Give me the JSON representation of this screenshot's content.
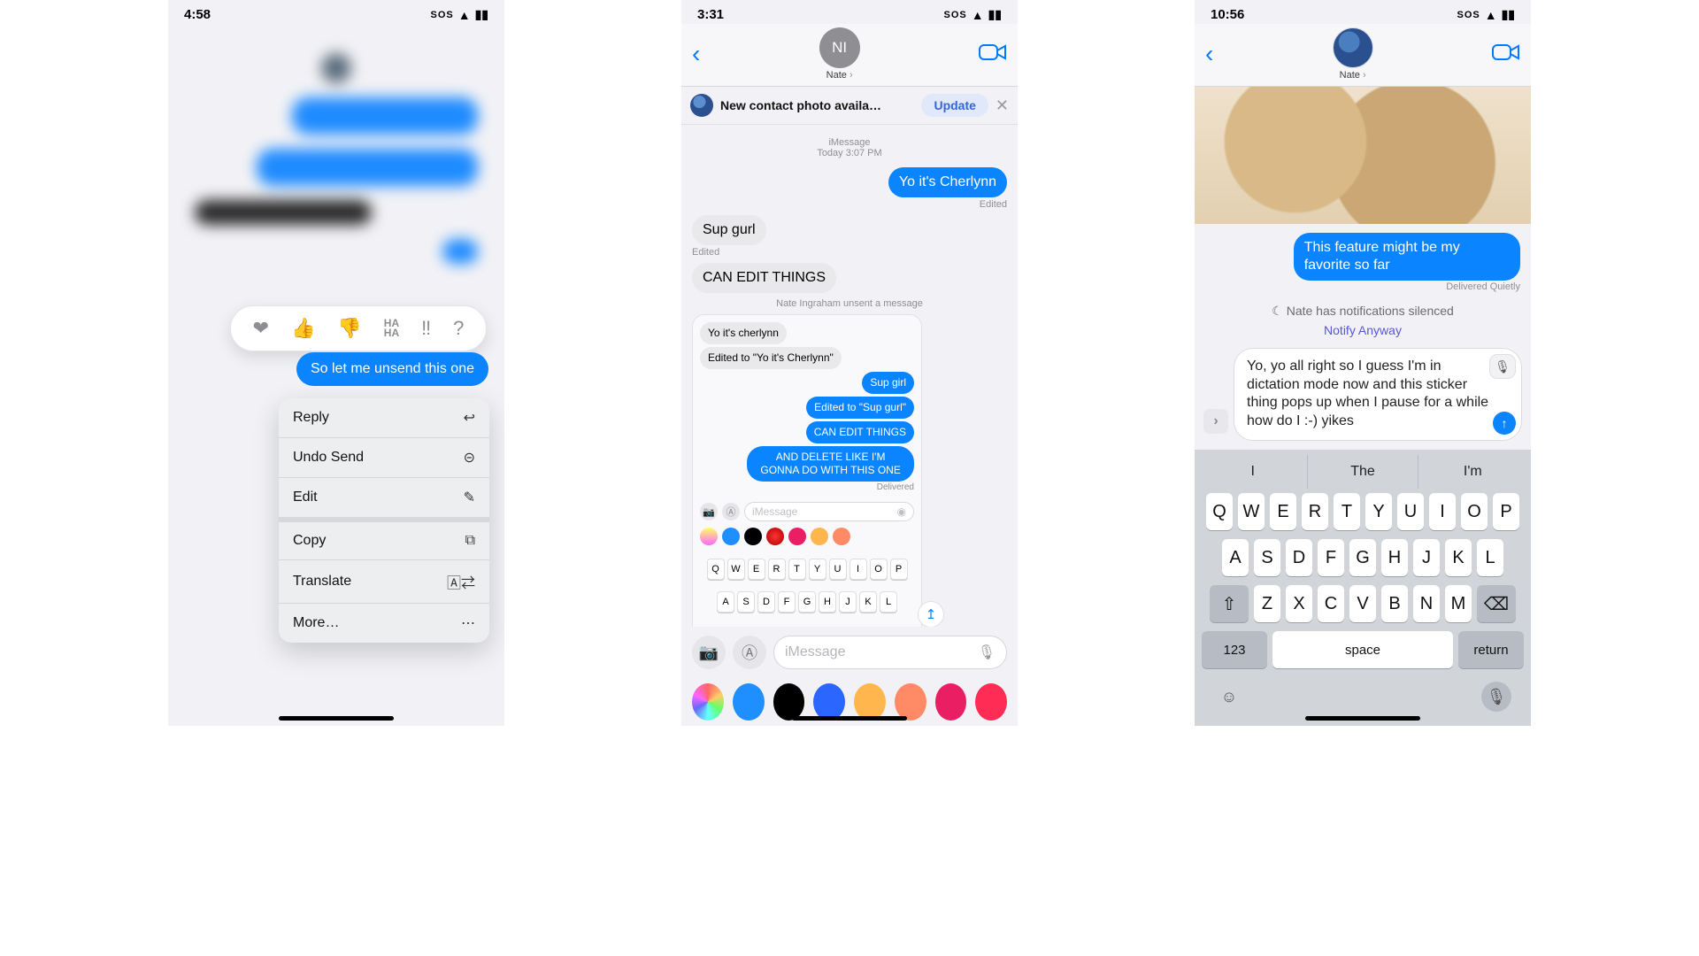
{
  "status": {
    "sos": "SOS",
    "wifi": "􀙇",
    "batt": "􀛨"
  },
  "phone1": {
    "time": "4:58",
    "tapback": [
      "❤︎",
      "👍",
      "👎",
      "HA HA",
      "‼︎",
      "?"
    ],
    "highlight_msg": "So let me unsend this one",
    "menu": [
      {
        "label": "Reply",
        "icon": "↩︎"
      },
      {
        "label": "Undo Send",
        "icon": "⊝"
      },
      {
        "label": "Edit",
        "icon": "✎"
      },
      {
        "label": "Copy",
        "icon": "⧉"
      },
      {
        "label": "Translate",
        "icon": "🄰⇄"
      },
      {
        "label": "More…",
        "icon": "⋯"
      }
    ]
  },
  "phone2": {
    "time": "3:31",
    "initials": "NI",
    "name": "Nate",
    "banner_text": "New contact photo availa…",
    "banner_button": "Update",
    "ts1": "iMessage",
    "ts2": "Today 3:07 PM",
    "m_sent1": "Yo it's Cherlynn",
    "edited": "Edited",
    "m_recv1": "Sup gurl",
    "m_recv2": "CAN EDIT THINGS",
    "unsent": "Nate Ingraham unsent a message",
    "inner": {
      "r1": "Yo it's cherlynn",
      "r2": "Edited to \"Yo it's Cherlynn\"",
      "s1": "Sup girl",
      "s2": "Edited to \"Sup gurl\"",
      "s3": "CAN EDIT THINGS",
      "s4": "AND DELETE LIKE I'M GONNA DO WITH THIS ONE",
      "delivered": "Delivered",
      "placeholder": "iMessage",
      "krow1": [
        "Q",
        "W",
        "E",
        "R",
        "T",
        "Y",
        "U",
        "I",
        "O",
        "P"
      ],
      "krow2": [
        "A",
        "S",
        "D",
        "F",
        "G",
        "H",
        "J",
        "K",
        "L"
      ]
    },
    "compose_placeholder": "iMessage"
  },
  "phone3": {
    "time": "10:56",
    "name": "Nate",
    "m_sent1": "This feature might be my favorite so far",
    "delivered_quietly": "Delivered Quietly",
    "silenced": "Nate has notifications silenced",
    "notify": "Notify Anyway",
    "dictation": "Yo, yo all right so I guess I'm in dictation mode now and this sticker thing pops up when I pause for a while how do I :-) yikes",
    "predict": [
      "I",
      "The",
      "I'm"
    ],
    "rows": {
      "r1": [
        "Q",
        "W",
        "E",
        "R",
        "T",
        "Y",
        "U",
        "I",
        "O",
        "P"
      ],
      "r2": [
        "A",
        "S",
        "D",
        "F",
        "G",
        "H",
        "J",
        "K",
        "L"
      ],
      "r3": [
        "Z",
        "X",
        "C",
        "V",
        "B",
        "N",
        "M"
      ]
    },
    "numkey": "123",
    "space": "space",
    "return": "return"
  }
}
